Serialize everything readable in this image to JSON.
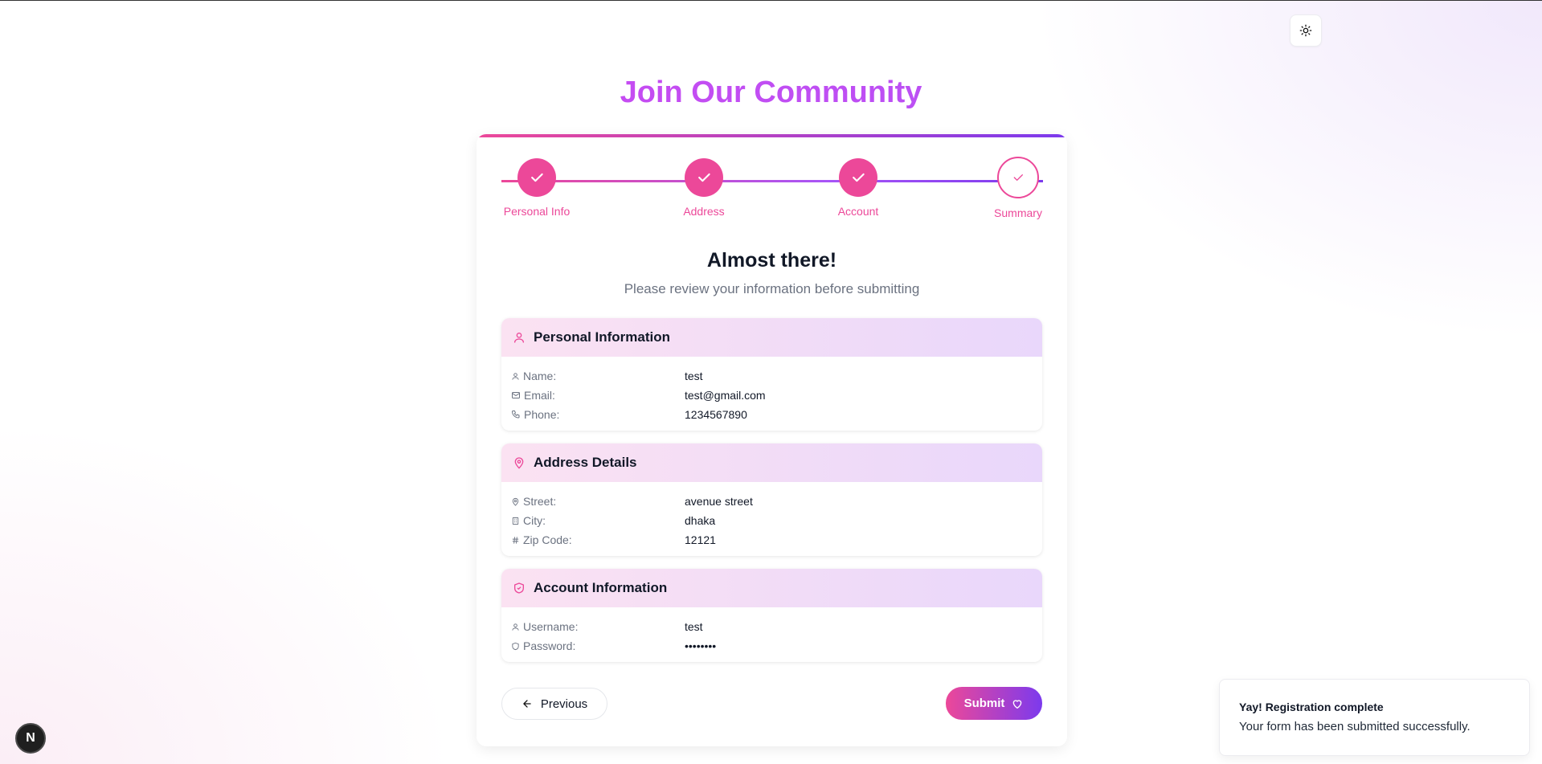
{
  "page": {
    "title": "Join Our Community"
  },
  "stepper": {
    "steps": [
      {
        "label": "Personal Info",
        "state": "completed"
      },
      {
        "label": "Address",
        "state": "completed"
      },
      {
        "label": "Account",
        "state": "completed"
      },
      {
        "label": "Summary",
        "state": "current"
      }
    ]
  },
  "summary": {
    "heading": "Almost there!",
    "subheading": "Please review your information before submitting",
    "personal": {
      "title": "Personal Information",
      "name_label": "Name:",
      "name_value": "test",
      "email_label": "Email:",
      "email_value": "test@gmail.com",
      "phone_label": "Phone:",
      "phone_value": "1234567890"
    },
    "address": {
      "title": "Address Details",
      "street_label": "Street:",
      "street_value": "avenue street",
      "city_label": "City:",
      "city_value": "dhaka",
      "zip_label": "Zip Code:",
      "zip_value": "12121"
    },
    "account": {
      "title": "Account Information",
      "username_label": "Username:",
      "username_value": "test",
      "password_label": "Password:",
      "password_value": "••••••••"
    }
  },
  "actions": {
    "previous_label": "Previous",
    "submit_label": "Submit"
  },
  "toast": {
    "title": "Yay! Registration complete",
    "description": "Your form has been submitted successfully."
  },
  "nextjs_badge": {
    "letter": "N"
  },
  "colors": {
    "accent_pink": "#ec4899",
    "accent_purple": "#7c3aed"
  },
  "icons": {
    "theme_toggle": "sun-icon",
    "step_completed": "check-icon",
    "personal_section": "user-icon",
    "address_section": "map-pin-icon",
    "account_section": "shield-icon",
    "previous": "arrow-left-icon",
    "submit": "heart-icon"
  }
}
